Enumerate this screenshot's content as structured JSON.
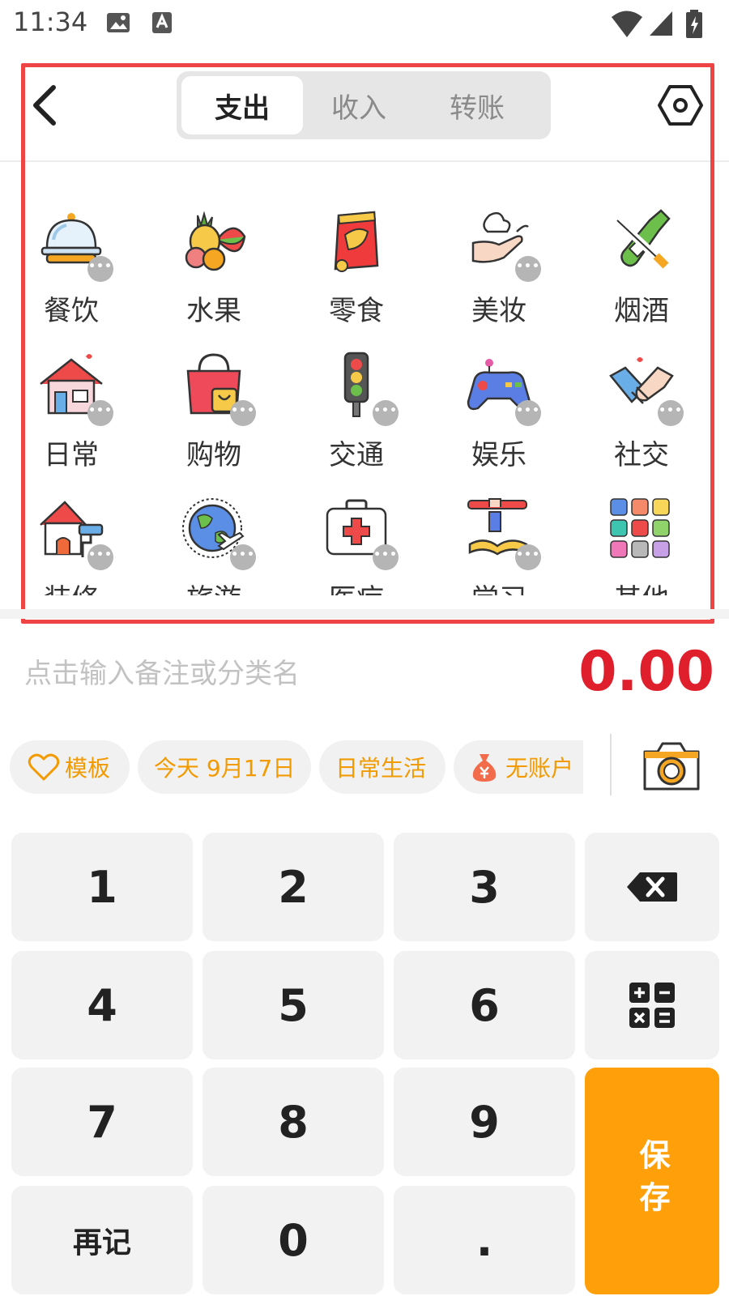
{
  "status_bar": {
    "time": "11:34"
  },
  "header": {
    "tabs": [
      {
        "label": "支出",
        "active": true
      },
      {
        "label": "收入",
        "active": false
      },
      {
        "label": "转账",
        "active": false
      }
    ]
  },
  "categories": [
    {
      "label": "餐饮",
      "icon": "dining-cloche-icon"
    },
    {
      "label": "水果",
      "icon": "fruit-icon"
    },
    {
      "label": "零食",
      "icon": "snack-bag-icon"
    },
    {
      "label": "美妆",
      "icon": "cosmetics-hand-icon"
    },
    {
      "label": "烟酒",
      "icon": "tobacco-wine-icon"
    },
    {
      "label": "日常",
      "icon": "house-icon"
    },
    {
      "label": "购物",
      "icon": "shopping-bag-icon"
    },
    {
      "label": "交通",
      "icon": "traffic-light-icon"
    },
    {
      "label": "娱乐",
      "icon": "gamepad-icon"
    },
    {
      "label": "社交",
      "icon": "handshake-icon"
    },
    {
      "label": "装修",
      "icon": "renovation-icon"
    },
    {
      "label": "旅游",
      "icon": "globe-plane-icon"
    },
    {
      "label": "医疗",
      "icon": "medical-kit-icon"
    },
    {
      "label": "学习",
      "icon": "book-pencil-icon"
    },
    {
      "label": "其他",
      "icon": "color-grid-icon"
    }
  ],
  "note": {
    "placeholder": "点击输入备注或分类名"
  },
  "amount": "0.00",
  "chips": {
    "template": "模板",
    "date": "今天 9月17日",
    "ledger": "日常生活",
    "account": "无账户"
  },
  "keypad": {
    "keys": [
      "1",
      "2",
      "3",
      "4",
      "5",
      "6",
      "7",
      "8",
      "9",
      "再记",
      "0",
      "."
    ],
    "save": "保存"
  },
  "colors": {
    "accent_orange": "#ff9f0a",
    "amount_red": "#e01f2c",
    "highlight_red": "#ef4444"
  }
}
